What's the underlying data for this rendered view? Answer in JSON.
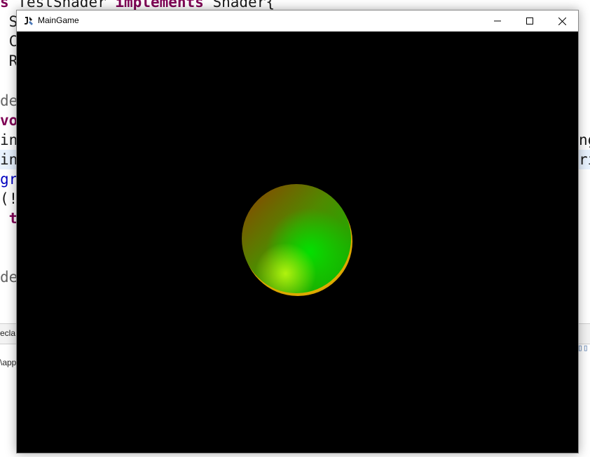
{
  "editor": {
    "lines": [
      {
        "parts": [
          {
            "t": "s ",
            "c": "kw"
          },
          {
            "t": "TestShader ",
            "c": ""
          },
          {
            "t": "implements",
            "c": "kw"
          },
          {
            "t": " Shader{",
            "c": ""
          }
        ]
      },
      {
        "parts": [
          {
            "t": " S",
            "c": ""
          }
        ]
      },
      {
        "parts": [
          {
            "t": " C",
            "c": ""
          }
        ]
      },
      {
        "parts": [
          {
            "t": " R",
            "c": ""
          }
        ]
      },
      {
        "parts": [
          {
            "t": "",
            "c": ""
          }
        ]
      },
      {
        "parts": [
          {
            "t": "de",
            "c": "ann"
          }
        ]
      },
      {
        "parts": [
          {
            "t": "vo",
            "c": "kw"
          }
        ]
      },
      {
        "parts": [
          {
            "t": "in",
            "c": ""
          }
        ]
      },
      {
        "parts": [
          {
            "t": "in",
            "c": ""
          }
        ]
      },
      {
        "parts": [
          {
            "t": "gr",
            "c": "blue"
          }
        ]
      },
      {
        "parts": [
          {
            "t": "(!",
            "c": ""
          }
        ]
      },
      {
        "parts": [
          {
            "t": " t",
            "c": "kw"
          }
        ]
      },
      {
        "parts": [
          {
            "t": "",
            "c": ""
          }
        ]
      },
      {
        "parts": [
          {
            "t": "",
            "c": ""
          }
        ]
      },
      {
        "parts": [
          {
            "t": "de",
            "c": "ann"
          }
        ]
      }
    ],
    "right_fragments": [
      "ng",
      "ri"
    ]
  },
  "panel": {
    "tab_label": "ecla",
    "path_text": "\\app"
  },
  "window": {
    "title": "MainGame",
    "minimize_glyph": "—",
    "maximize_glyph": "☐",
    "close_glyph": "✕"
  },
  "scene": {
    "object": "sphere",
    "background_color": "#000000",
    "colors": [
      "#8a3a00",
      "#00c800",
      "#b8e000",
      "#ffd000"
    ]
  }
}
